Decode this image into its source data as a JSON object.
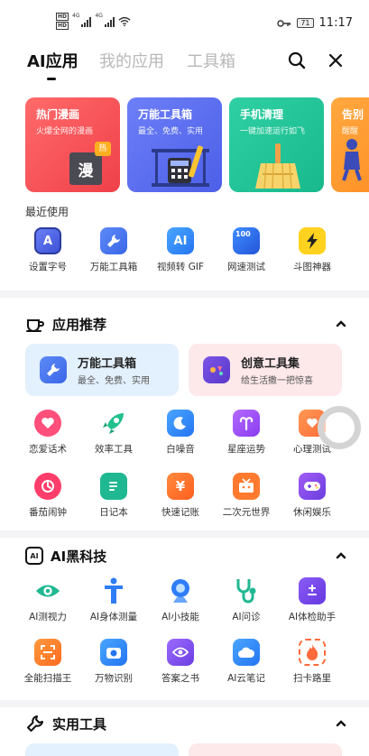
{
  "status": {
    "time": "11:17",
    "battery": "71",
    "network1": "4G",
    "network2": "4G",
    "hd": "HD"
  },
  "tabs": [
    {
      "label": "AI应用"
    },
    {
      "label": "我的应用"
    },
    {
      "label": "工具箱"
    }
  ],
  "banners": [
    {
      "title": "热门漫画",
      "sub": "火爆全网的漫画",
      "color": "#f2535a",
      "art_text": "漫",
      "badge": "热"
    },
    {
      "title": "万能工具箱",
      "sub": "最全、免费、实用",
      "color": "#5b71f0"
    },
    {
      "title": "手机清理",
      "sub": "一键加速运行如飞",
      "color": "#23c59a"
    },
    {
      "title": "告别",
      "sub": "醒醒",
      "color": "#ff9a2e"
    }
  ],
  "recent": {
    "title": "最近使用",
    "items": [
      {
        "label": "设置字号",
        "icon": "font-size-icon",
        "glyph": "A"
      },
      {
        "label": "万能工具箱",
        "icon": "wrench-icon",
        "glyph": ""
      },
      {
        "label": "视频转 GIF",
        "icon": "ai-icon",
        "glyph": "AI"
      },
      {
        "label": "网速测试",
        "icon": "speed-icon",
        "glyph": "100"
      },
      {
        "label": "斗图神器",
        "icon": "lightning-icon",
        "glyph": ""
      }
    ]
  },
  "recommend": {
    "title": "应用推荐",
    "cards": [
      {
        "title": "万能工具箱",
        "sub": "最全、免费、实用"
      },
      {
        "title": "创意工具集",
        "sub": "给生活撒一把惊喜"
      }
    ],
    "row1": [
      {
        "label": "恋爱话术",
        "icon": "heart-chat-icon"
      },
      {
        "label": "效率工具",
        "icon": "rocket-icon"
      },
      {
        "label": "白噪音",
        "icon": "moon-icon"
      },
      {
        "label": "星座运势",
        "icon": "aries-icon"
      },
      {
        "label": "心理测试",
        "icon": "heart-doc-icon"
      }
    ],
    "row2": [
      {
        "label": "番茄闹钟",
        "icon": "tomato-clock-icon"
      },
      {
        "label": "日记本",
        "icon": "notebook-icon"
      },
      {
        "label": "快速记账",
        "icon": "yen-book-icon",
        "glyph": "¥"
      },
      {
        "label": "二次元世界",
        "icon": "tv-icon"
      },
      {
        "label": "休闲娱乐",
        "icon": "gamepad-icon"
      }
    ]
  },
  "ai_tech": {
    "title": "AI黑科技",
    "badge": "AI",
    "row1": [
      {
        "label": "AI测视力",
        "icon": "eye-icon"
      },
      {
        "label": "AI身体测量",
        "icon": "body-icon"
      },
      {
        "label": "AI小技能",
        "icon": "lens-icon"
      },
      {
        "label": "AI问诊",
        "icon": "stethoscope-icon"
      },
      {
        "label": "AI体检助手",
        "icon": "checkup-icon"
      }
    ],
    "row2": [
      {
        "label": "全能扫描王",
        "icon": "scan-icon"
      },
      {
        "label": "万物识别",
        "icon": "camera-icon"
      },
      {
        "label": "答案之书",
        "icon": "answer-book-icon"
      },
      {
        "label": "AI云笔记",
        "icon": "cloud-note-icon"
      },
      {
        "label": "扫卡路里",
        "icon": "flame-icon"
      }
    ]
  },
  "utility": {
    "title": "实用工具"
  }
}
